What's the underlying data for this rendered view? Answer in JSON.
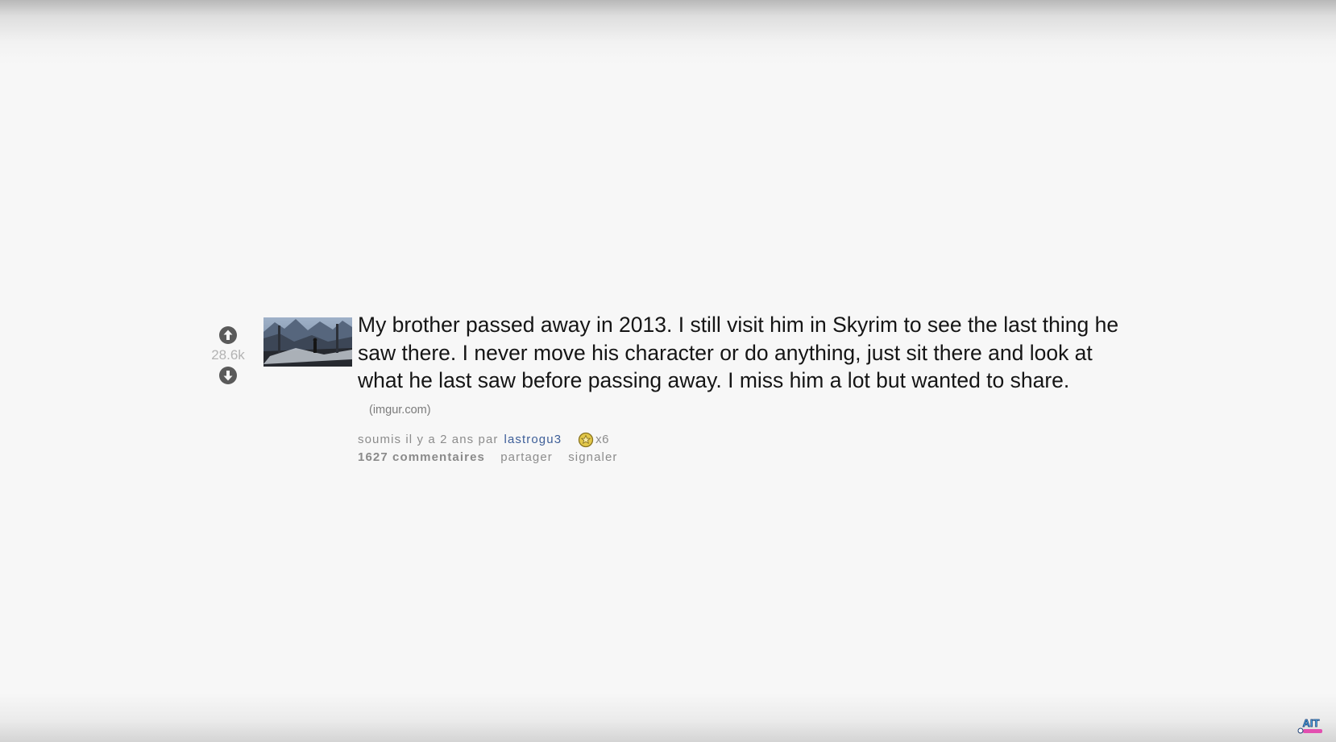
{
  "post": {
    "score": "28.6k",
    "title": "My brother passed away in 2013. I still visit him in Skyrim to see the last thing he saw there. I never move his character or do anything, just sit there and look at what he last saw before passing away. I miss him a lot but wanted to share.",
    "domain": "(imgur.com)",
    "submitted_prefix": "soumis il y a 2 ans par",
    "author": "lastrogu3",
    "award_count": "x6",
    "comments": "1627 commentaires",
    "share": "partager",
    "report": "signaler"
  },
  "watermark": {
    "text": "AIT"
  },
  "colors": {
    "background": "#f7f7f7",
    "title": "#151515",
    "author_link": "#3d5e98",
    "meta": "#8c8c8c",
    "score": "#b3b3b3",
    "award": "#d8b82a"
  },
  "icons": {
    "upvote": "upvote-arrow-icon",
    "downvote": "downvote-arrow-icon",
    "award": "gold-award-icon",
    "watermark": "channel-logo-icon"
  }
}
